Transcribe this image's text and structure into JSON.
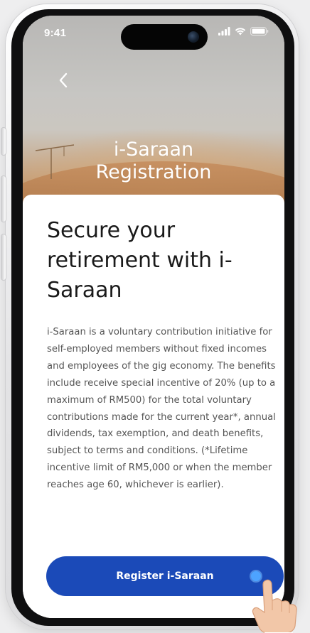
{
  "status_bar": {
    "time": "9:41",
    "icons": [
      "signal-icon",
      "wifi-icon",
      "battery-icon"
    ]
  },
  "header": {
    "back_icon": "chevron-left-icon",
    "title_line1": "i-Saraan",
    "title_line2": "Registration"
  },
  "content": {
    "headline": "Secure your retirement with i-Saraan",
    "description": "i-Saraan is a voluntary contribution initiative for self-employed members without fixed incomes and employees of the gig economy. The benefits include receive special incentive of 20% (up to a maximum of RM500) for the total voluntary contributions made for the current year*, annual dividends, tax exemption, and death benefits, subject to terms and conditions. (*Lifetime incentive limit of RM5,000 or when the member reaches age 60, whichever is earlier)."
  },
  "cta": {
    "label": "Register i-Saraan"
  },
  "colors": {
    "primary_button": "#1b4ab8",
    "headline_text": "#1a1a1a",
    "body_text": "#555555",
    "tap_indicator": "#4da3ff"
  }
}
